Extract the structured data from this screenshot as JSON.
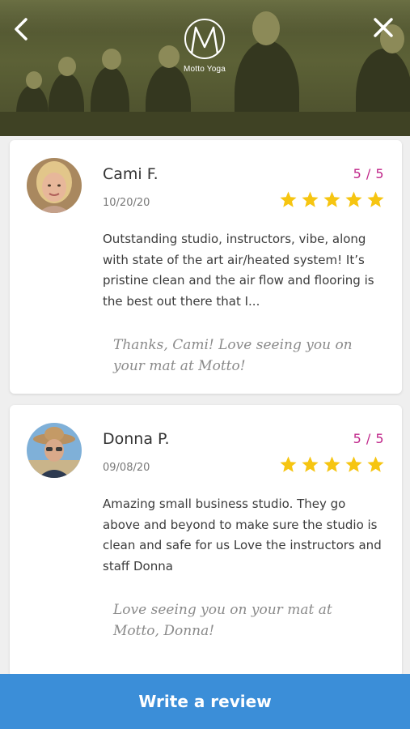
{
  "header": {
    "brand_name": "Motto Yoga",
    "back_icon": "chevron-left-icon",
    "close_icon": "close-icon"
  },
  "reviews": [
    {
      "name": "Cami F.",
      "date": "10/20/20",
      "score": "5 / 5",
      "rating": 5,
      "body": "Outstanding studio, instructors, vibe, along with state of the art air/heated system! It’s pristine clean and the air flow and flooring is the best out there that I...",
      "reply": "Thanks, Cami! Love seeing you on your mat at Motto!"
    },
    {
      "name": "Donna P.",
      "date": "09/08/20",
      "score": "5 / 5",
      "rating": 5,
      "body": "Amazing small business studio. They go above and beyond to make sure the studio is clean and safe for us Love the instructors and staff Donna",
      "reply": "Love seeing you on your mat at Motto, Donna!"
    }
  ],
  "footer": {
    "write_review_label": "Write a review"
  },
  "colors": {
    "accent": "#3b8ed8",
    "score": "#c0278a",
    "star": "#f6c511"
  }
}
